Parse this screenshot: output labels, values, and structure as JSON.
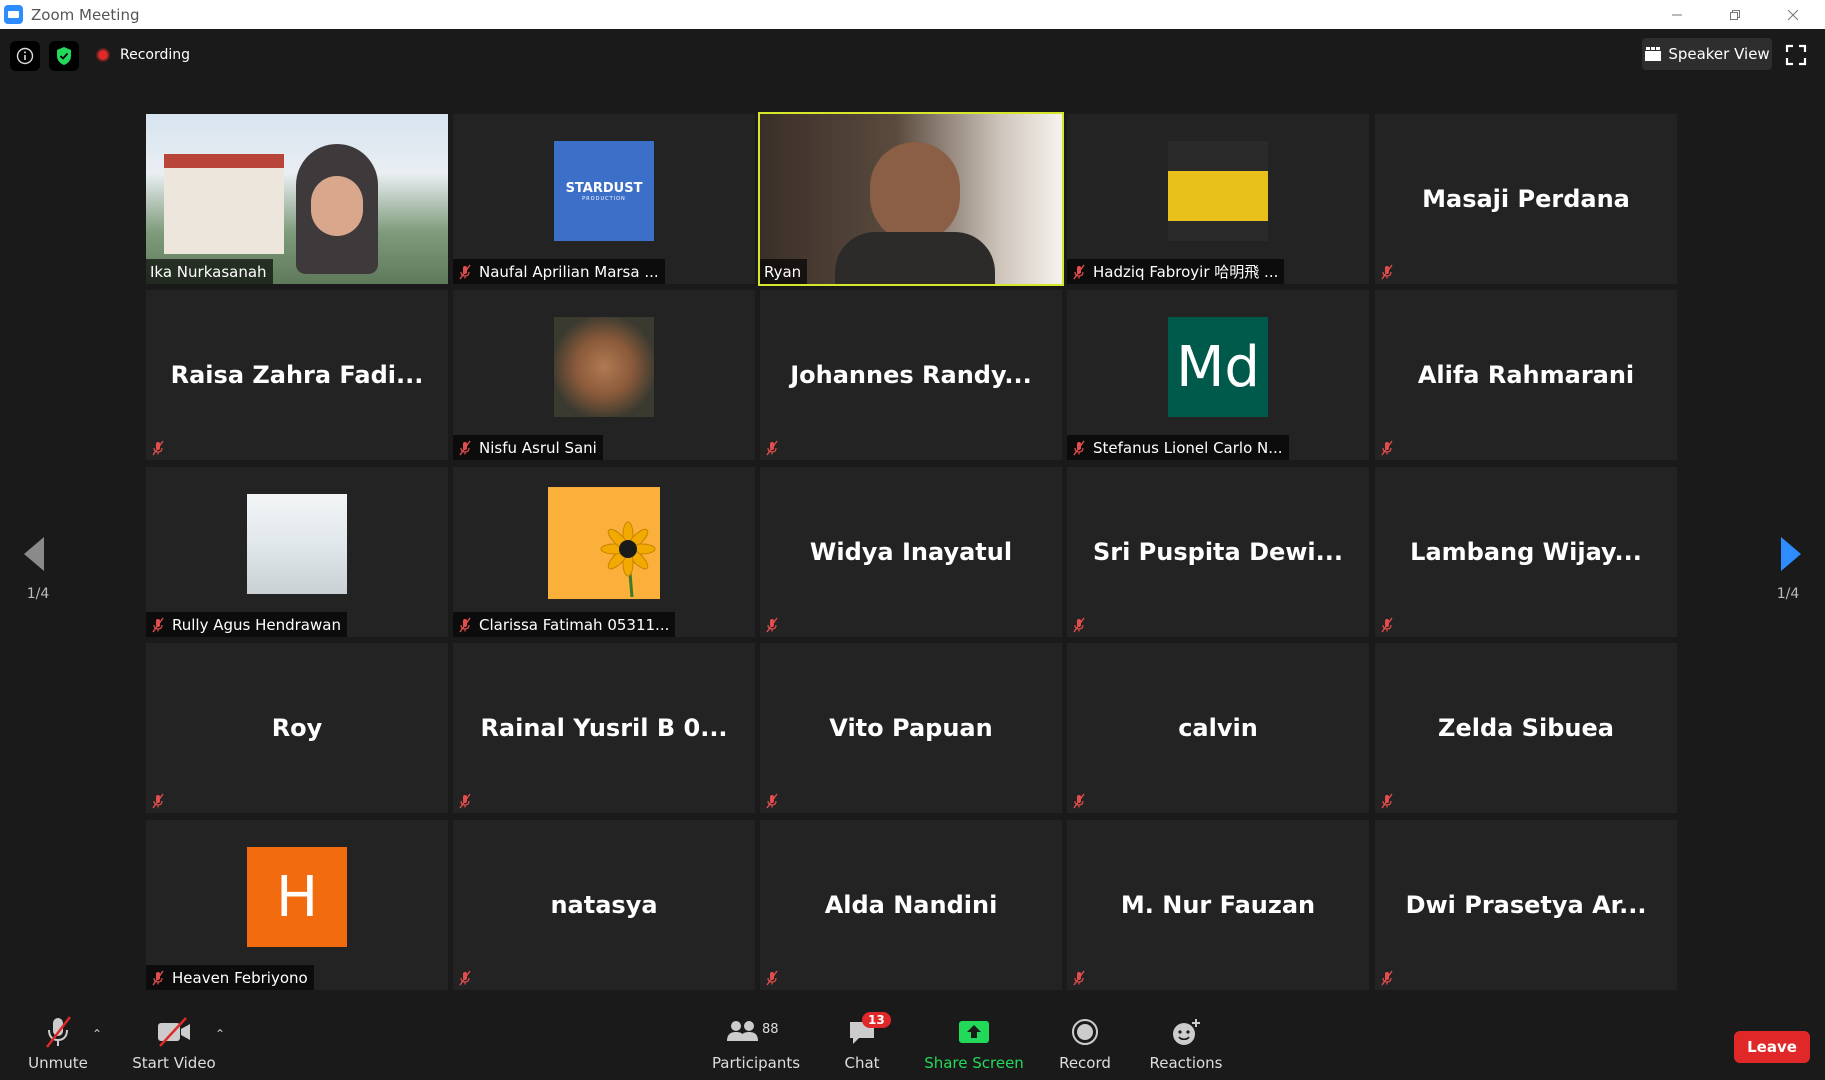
{
  "window": {
    "title": "Zoom Meeting"
  },
  "topbar": {
    "recording_label": "Recording",
    "view_label": "Speaker View"
  },
  "nav": {
    "page_left": "1/4",
    "page_right": "1/4"
  },
  "tiles": [
    {
      "name": "Ika Nurkasanah",
      "kind": "video",
      "muted": false
    },
    {
      "name": "Naufal Aprilian Marsa ...",
      "kind": "logo",
      "logo_text": "STARDUST",
      "logo_sub": "PRODUCTION",
      "muted": true
    },
    {
      "name": "Ryan",
      "kind": "video",
      "muted": false,
      "active": true
    },
    {
      "name": "Hadziq Fabroyir 哈明飛 ...",
      "kind": "photo",
      "muted": true
    },
    {
      "name": "Masaji Perdana",
      "kind": "name",
      "muted": true
    },
    {
      "name": "Raisa Zahra Fadi...",
      "kind": "name",
      "muted": true
    },
    {
      "name": "Nisfu Asrul Sani",
      "kind": "photo",
      "muted": true
    },
    {
      "name": "Johannes Randy...",
      "kind": "name",
      "muted": true
    },
    {
      "name": "Stefanus Lionel Carlo N...",
      "kind": "letter",
      "letter": "Md",
      "color": "#005a4c",
      "muted": true
    },
    {
      "name": "Alifa Rahmarani",
      "kind": "name",
      "muted": true
    },
    {
      "name": "Rully Agus Hendrawan",
      "kind": "photo",
      "muted": true
    },
    {
      "name": "Clarissa Fatimah 05311...",
      "kind": "sunflower",
      "muted": true
    },
    {
      "name": "Widya Inayatul",
      "kind": "name",
      "muted": true
    },
    {
      "name": "Sri Puspita Dewi...",
      "kind": "name",
      "muted": true
    },
    {
      "name": "Lambang Wijay...",
      "kind": "name",
      "muted": true
    },
    {
      "name": "Roy",
      "kind": "name",
      "muted": true
    },
    {
      "name": "Rainal Yusril B 0...",
      "kind": "name",
      "muted": true
    },
    {
      "name": "Vito Papuan",
      "kind": "name",
      "muted": true
    },
    {
      "name": "calvin",
      "kind": "name",
      "muted": true
    },
    {
      "name": "Zelda Sibuea",
      "kind": "name",
      "muted": true
    },
    {
      "name": "Heaven Febriyono",
      "kind": "letter",
      "letter": "H",
      "color": "#f26b0f",
      "muted": true
    },
    {
      "name": "natasya",
      "kind": "name",
      "muted": true
    },
    {
      "name": "Alda Nandini",
      "kind": "name",
      "muted": true
    },
    {
      "name": "M. Nur Fauzan",
      "kind": "name",
      "muted": true
    },
    {
      "name": "Dwi Prasetya Ar...",
      "kind": "name",
      "muted": true
    }
  ],
  "toolbar": {
    "unmute": "Unmute",
    "start_video": "Start Video",
    "participants": "Participants",
    "participants_count": "88",
    "chat": "Chat",
    "chat_badge": "13",
    "share_screen": "Share Screen",
    "record": "Record",
    "reactions": "Reactions",
    "leave": "Leave"
  },
  "colors": {
    "accent_green": "#23d959",
    "active_border": "#d6e62a",
    "leave_red": "#e02828",
    "nav_blue": "#2d8cff"
  }
}
